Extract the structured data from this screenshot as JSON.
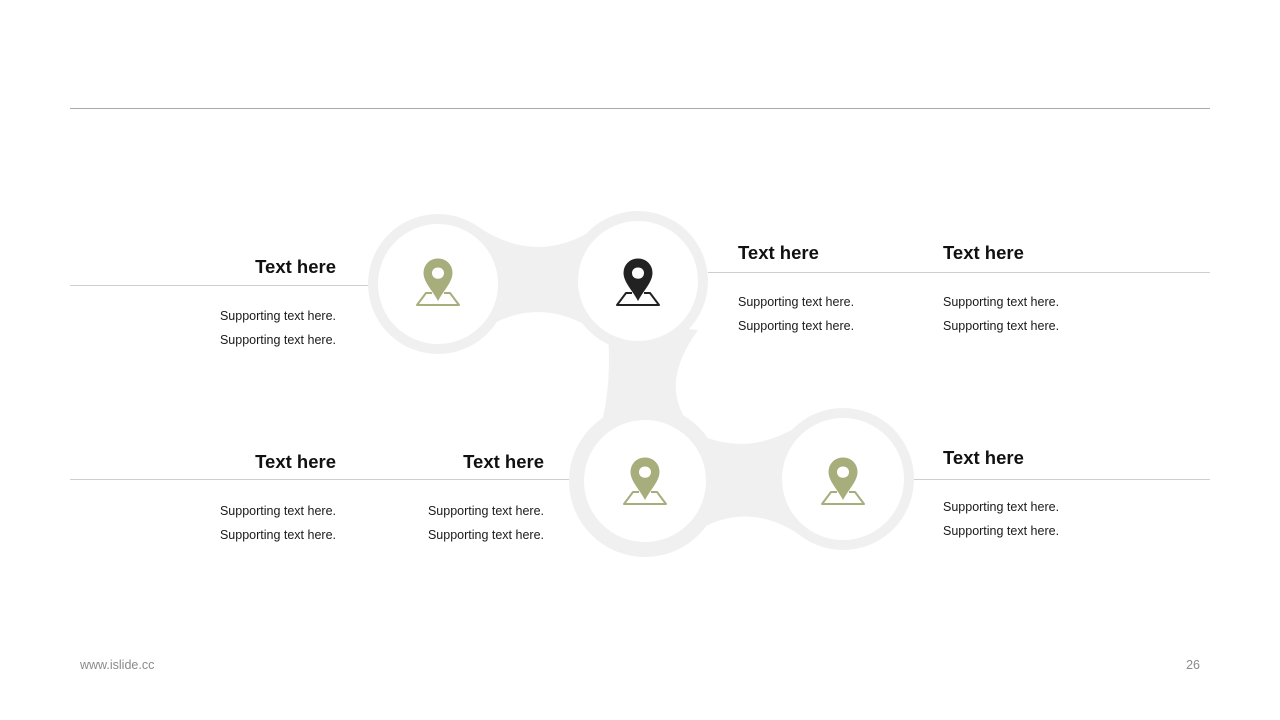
{
  "colors": {
    "accent": "#a7ad7b",
    "highlight": "#222222",
    "ring": "#f0f0f0",
    "rule": "#a9a9a9",
    "divider": "#cfcfcf"
  },
  "nodes": [
    {
      "icon": "map-pin-icon",
      "highlighted": false
    },
    {
      "icon": "map-pin-icon",
      "highlighted": true
    },
    {
      "icon": "map-pin-icon",
      "highlighted": false
    },
    {
      "icon": "map-pin-icon",
      "highlighted": false
    }
  ],
  "blocks": [
    {
      "heading": "Text here",
      "lines": [
        "Supporting  text here.",
        "Supporting  text here."
      ]
    },
    {
      "heading": "Text here",
      "lines": [
        "Supporting  text here.",
        "Supporting  text here."
      ]
    },
    {
      "heading": "Text here",
      "lines": [
        "Supporting  text here.",
        "Supporting  text here."
      ]
    },
    {
      "heading": "Text here",
      "lines": [
        "Supporting  text here.",
        "Supporting  text here."
      ]
    },
    {
      "heading": "Text here",
      "lines": [
        "Supporting  text here.",
        "Supporting  text here."
      ]
    },
    {
      "heading": "Text here",
      "lines": [
        "Supporting  text here.",
        "Supporting  text here."
      ]
    }
  ],
  "footer": {
    "url": "www.islide.cc",
    "page": "26"
  }
}
